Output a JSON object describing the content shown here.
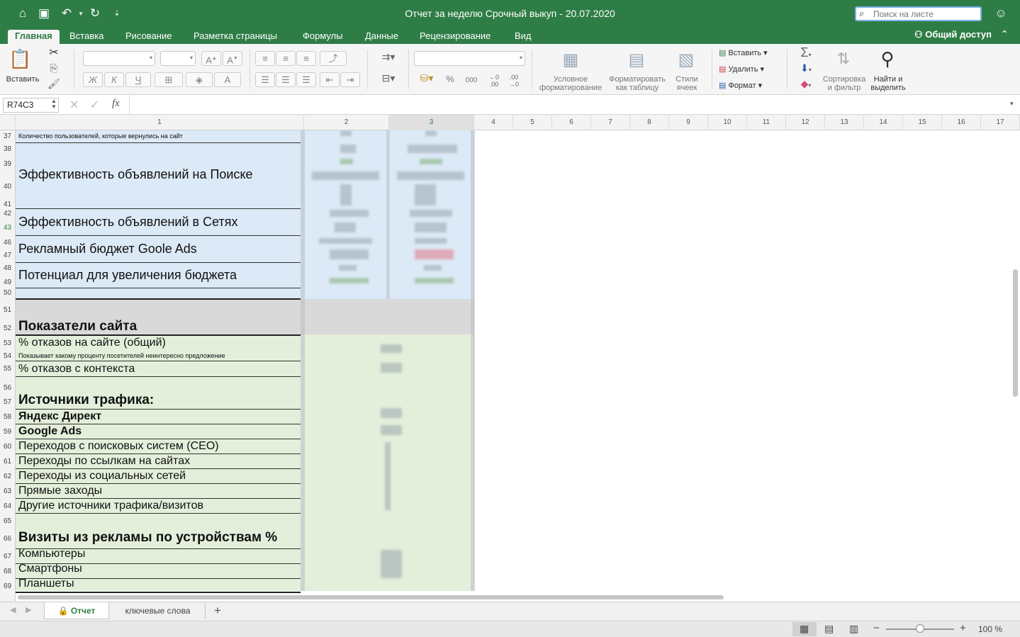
{
  "titlebar": {
    "title": "Отчет за неделю Срочный выкуп - 20.07.2020",
    "search_placeholder": "Поиск на листе"
  },
  "menu": {
    "tabs": [
      "Главная",
      "Вставка",
      "Рисование",
      "Разметка страницы",
      "Формулы",
      "Данные",
      "Рецензирование",
      "Вид"
    ],
    "share_label": "Общий доступ"
  },
  "ribbon": {
    "paste": "Вставить",
    "cond_format": [
      "Условное",
      "форматирование"
    ],
    "format_table": [
      "Форматировать",
      "как таблицу"
    ],
    "cell_styles": [
      "Стили",
      "ячеек"
    ],
    "insert": "Вставить",
    "delete": "Удалить",
    "format": "Формат",
    "sort_filter": [
      "Сортировка",
      "и фильтр"
    ],
    "find_select": [
      "Найти и",
      "выделить"
    ],
    "bold": "Ж",
    "italic": "К",
    "underline": "Ч",
    "percent": "%",
    "thousands": "000"
  },
  "formula_bar": {
    "name_box": "R74C3",
    "fx": "fx"
  },
  "columns": [
    "1",
    "2",
    "3",
    "4",
    "5",
    "6",
    "7",
    "8",
    "9",
    "10",
    "11",
    "12",
    "13",
    "14",
    "15",
    "16",
    "17"
  ],
  "rows": [
    {
      "n": "37",
      "text": "Количество пользователей, которые вернулись на сайт"
    },
    {
      "n": "38",
      "text": ""
    },
    {
      "n": "39",
      "text": ""
    },
    {
      "n": "40",
      "text": ""
    },
    {
      "n": "41",
      "text": ""
    },
    {
      "n": "42",
      "text": ""
    },
    {
      "n": "43",
      "text": ""
    },
    {
      "n": "46",
      "text": ""
    },
    {
      "n": "47",
      "text": ""
    },
    {
      "n": "48",
      "text": ""
    },
    {
      "n": "49",
      "text": ""
    },
    {
      "n": "50",
      "text": ""
    },
    {
      "n": "51",
      "text": ""
    },
    {
      "n": "52",
      "text": "Показатели сайта"
    },
    {
      "n": "53",
      "text": "% отказов на сайте (общий)"
    },
    {
      "n": "54",
      "text": "Показывает какому проценту посетителей неинтересно предложение"
    },
    {
      "n": "55",
      "text": "% отказов с контекста"
    },
    {
      "n": "56",
      "text": ""
    },
    {
      "n": "57",
      "text": "Источники трафика:"
    },
    {
      "n": "58",
      "text": "Яндекс Директ"
    },
    {
      "n": "59",
      "text": "Google Ads"
    },
    {
      "n": "60",
      "text": "Переходов с поисковых систем (СЕО)"
    },
    {
      "n": "61",
      "text": "Переходы по ссылкам на сайтах"
    },
    {
      "n": "62",
      "text": "Переходы из социальных сетей"
    },
    {
      "n": "63",
      "text": "Прямые заходы"
    },
    {
      "n": "64",
      "text": "Другие источники трафика/визитов"
    },
    {
      "n": "65",
      "text": ""
    },
    {
      "n": "66",
      "text": "Визиты из рекламы по устройствам %"
    },
    {
      "n": "67",
      "text": "Компьютеры"
    },
    {
      "n": "68",
      "text": "Смартфоны"
    },
    {
      "n": "69",
      "text": "Планшеты"
    }
  ],
  "merged": {
    "search_ads": "Эффективность объявлений на Поиске",
    "network_ads": "Эффективность объявлений в Сетях",
    "budget": "Рекламный бюджет Goole Ads",
    "potential": "Потенциал для увеличения бюджета"
  },
  "sheets": [
    "Отчет",
    "ключевые слова"
  ],
  "status": {
    "zoom": "100 %"
  },
  "colors": {
    "accent": "#2f7d46",
    "blue_fill": "#dce9f6",
    "green_fill": "#e3efda",
    "gray_fill": "#d9d9d9"
  }
}
